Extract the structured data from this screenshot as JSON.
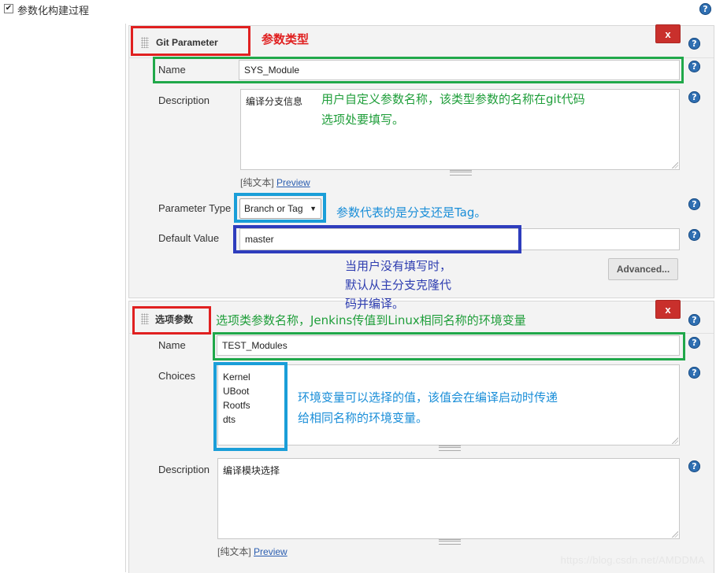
{
  "top": {
    "checkbox_mark": "✔",
    "label": "参数化构建过程",
    "help": "?"
  },
  "param1": {
    "header_title": "Git Parameter",
    "delete_label": "x",
    "name_label": "Name",
    "name_value": "SYS_Module",
    "description_label": "Description",
    "description_value": "编译分支信息",
    "preview_prefix": "[纯文本]",
    "preview_link": "Preview",
    "type_label": "Parameter Type",
    "type_value": "Branch or Tag",
    "type_arrow": "▼",
    "default_label": "Default Value",
    "default_value": "master",
    "advanced_label": "Advanced..."
  },
  "param2": {
    "header_title": "选项参数",
    "delete_label": "x",
    "name_label": "Name",
    "name_value": "TEST_Modules",
    "choices_label": "Choices",
    "choices_value": "Kernel\nUBoot\nRootfs\ndts",
    "description_label": "Description",
    "description_value": "编译模块选择",
    "preview_prefix": "[纯文本]",
    "preview_link": "Preview"
  },
  "annotations": {
    "param_type": "参数类型",
    "name_note_line1": "用户自定义参数名称，该类型参数的名称在git代码",
    "name_note_line2": "选项处要填写。",
    "type_note": "参数代表的是分支还是Tag。",
    "default_note_line1": "当用户没有填写时，",
    "default_note_line2": "默认从主分支克隆代",
    "default_note_line3": "码并编译。",
    "choice_name_note": "选项类参数名称，Jenkins传值到Linux相同名称的环境变量",
    "choices_note_line1": "环境变量可以选择的值，该值会在编译启动时传递",
    "choices_note_line2": "给相同名称的环境变量。"
  },
  "help_icon": "?",
  "watermark": "https://blog.csdn.net/AMDDMA"
}
